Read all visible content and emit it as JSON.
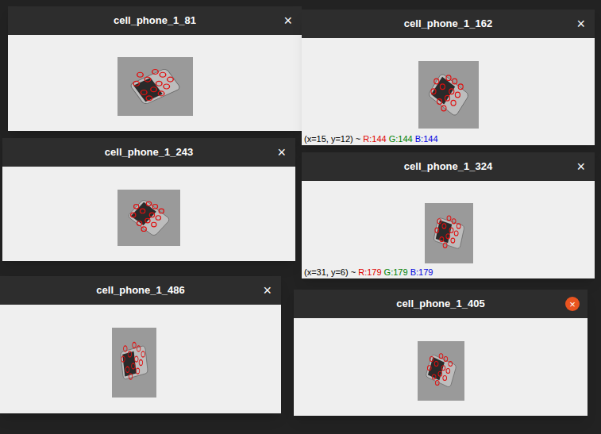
{
  "windows": [
    {
      "title": "cell_phone_1_81",
      "close": "×",
      "active": false,
      "status": null
    },
    {
      "title": "cell_phone_1_162",
      "close": "×",
      "active": false,
      "status": {
        "prefix": "(x=15, y=12) ~ ",
        "r": "R:144",
        "g": "G:144",
        "b": "B:144"
      }
    },
    {
      "title": "cell_phone_1_243",
      "close": "×",
      "active": false,
      "status": null
    },
    {
      "title": "cell_phone_1_324",
      "close": "×",
      "active": false,
      "status": {
        "prefix": "(x=31, y=6) ~ ",
        "r": "R:179",
        "g": "G:179",
        "b": "B:179"
      }
    },
    {
      "title": "cell_phone_1_486",
      "close": "×",
      "active": false,
      "status": null
    },
    {
      "title": "cell_phone_1_405",
      "close": "×",
      "active": true,
      "status": null
    }
  ]
}
